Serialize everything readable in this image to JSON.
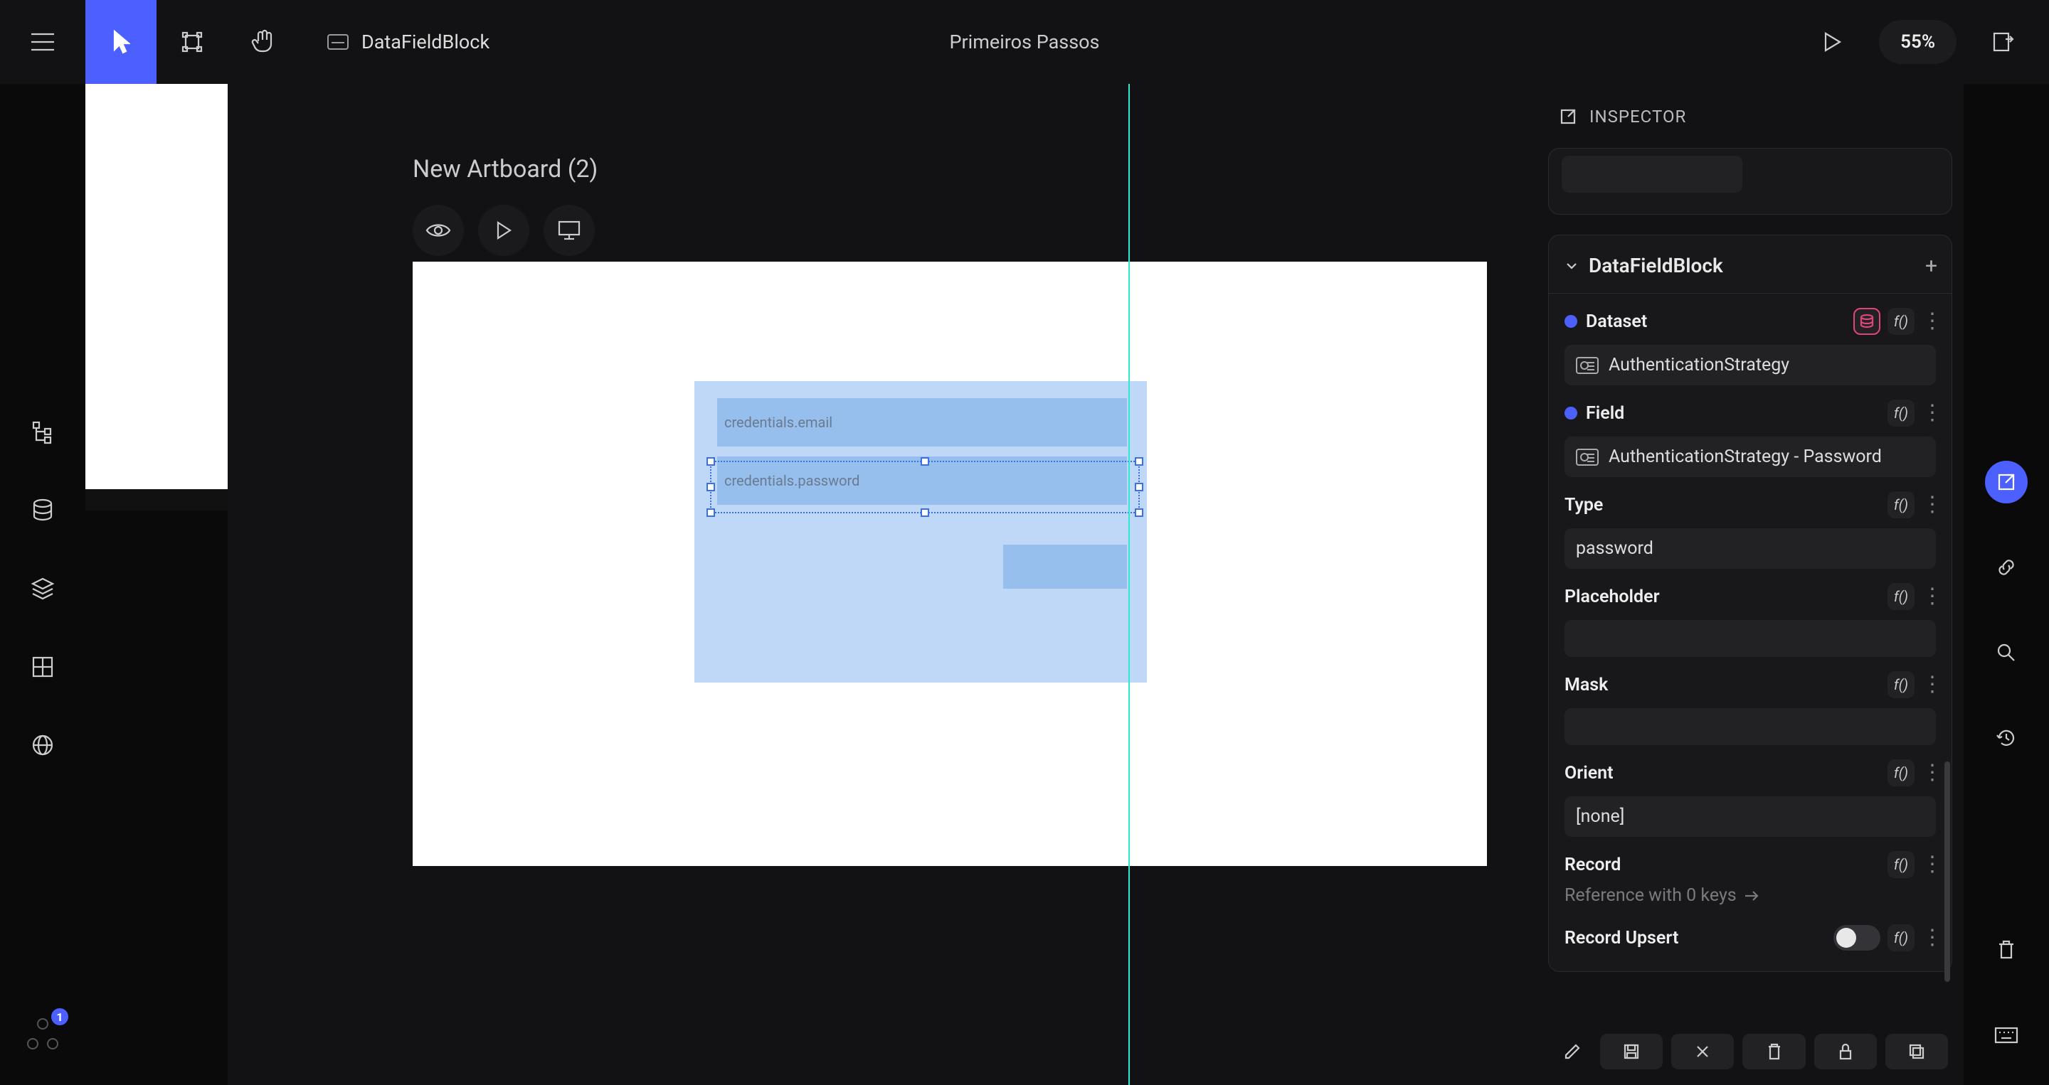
{
  "topbar": {
    "breadcrumb": "DataFieldBlock",
    "document_title": "Primeiros Passos",
    "zoom": "55%"
  },
  "leftrail": {
    "badge_count": "1"
  },
  "artboard": {
    "label": "New Artboard (2)",
    "fields": {
      "email_placeholder": "credentials.email",
      "password_placeholder": "credentials.password"
    }
  },
  "inspector": {
    "panel_title": "INSPECTOR",
    "component_name": "DataFieldBlock",
    "props": {
      "dataset": {
        "label": "Dataset",
        "value": "AuthenticationStrategy"
      },
      "field": {
        "label": "Field",
        "value": "AuthenticationStrategy - Password"
      },
      "type_": {
        "label": "Type",
        "value": "password"
      },
      "placeholder": {
        "label": "Placeholder",
        "value": ""
      },
      "mask": {
        "label": "Mask",
        "value": ""
      },
      "orient": {
        "label": "Orient",
        "value": "[none]"
      },
      "record": {
        "label": "Record",
        "hint": "Reference with 0 keys"
      },
      "record_upsert": {
        "label": "Record Upsert",
        "on": false
      }
    },
    "fx_label": "f()"
  }
}
